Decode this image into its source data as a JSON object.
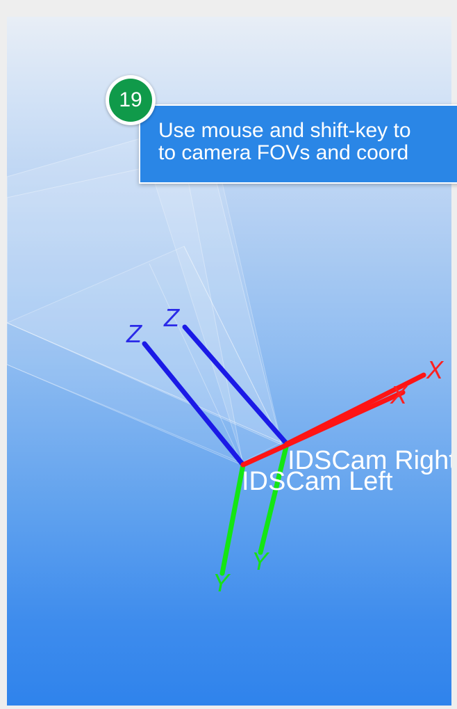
{
  "tutorial": {
    "step_number": "19",
    "callout_lines": [
      "Use mouse and shift-key to",
      "to camera FOVs and coord"
    ],
    "callout_color": "#2a86e6",
    "badge_color": "#109a4a"
  },
  "scene": {
    "cameras": [
      {
        "name": "IDSCam Right"
      },
      {
        "name": "IDSCam Left"
      }
    ],
    "axis_labels": {
      "x": "X",
      "y": "Y",
      "z": "Z"
    },
    "axis_colors": {
      "x": "#ff1414",
      "y": "#14e614",
      "z": "#1a1ae6"
    }
  }
}
